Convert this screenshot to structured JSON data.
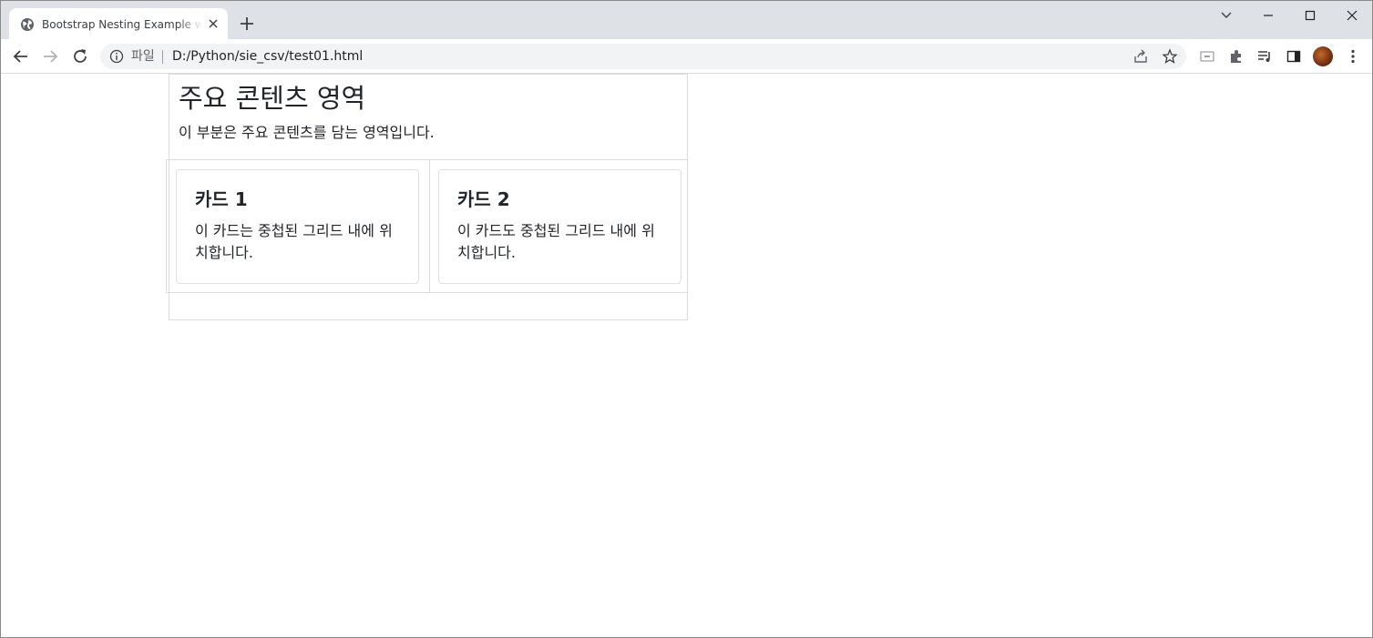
{
  "browser": {
    "tab": {
      "title": "Bootstrap Nesting Example with"
    },
    "address_bar": {
      "scheme_label": "파일",
      "url": "D:/Python/sie_csv/test01.html"
    }
  },
  "page": {
    "main": {
      "heading": "주요 콘텐츠 영역",
      "description": "이 부분은 주요 콘텐츠를 담는 영역입니다."
    },
    "cards": [
      {
        "title": "카드 1",
        "text": "이 카드는 중첩된 그리드 내에 위치합니다."
      },
      {
        "title": "카드 2",
        "text": "이 카드도 중첩된 그리드 내에 위치합니다."
      }
    ]
  }
}
